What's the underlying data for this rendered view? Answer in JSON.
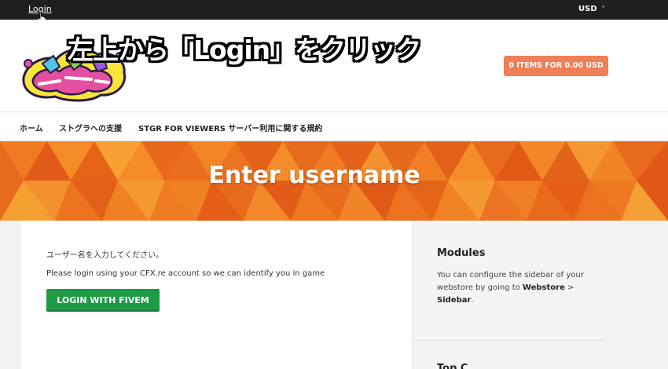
{
  "topbar": {
    "login_label": "Login",
    "currency_label": "USD",
    "currency_chevron": "˅"
  },
  "header": {
    "overlay_caption": "左上から「Login」をクリック",
    "cart_label": "0 ITEMS FOR 0.00 USD",
    "logo_icon": "graffiti-logo"
  },
  "nav": {
    "items": [
      {
        "label": "ホーム"
      },
      {
        "label": "ストグラへの支援"
      },
      {
        "label": "STGR FOR VIEWERS サーバー利用に関する規約"
      }
    ]
  },
  "banner": {
    "title": "Enter username"
  },
  "main": {
    "jp_instruction": "ユーザー名を入力してください。",
    "message": "Please login using your CFX.re account so we can identify you in game",
    "login_button": "LOGIN WITH FIVEM"
  },
  "sidebar": {
    "modules_title": "Modules",
    "modules_text_1": "You can configure the sidebar of your webstore by going to ",
    "modules_text_webstore": "Webstore",
    "modules_text_sep": " > ",
    "modules_text_sidebar": "Sidebar",
    "modules_text_end": ".",
    "next_title": "Top C"
  },
  "colors": {
    "topbar_bg": "#1f1f1f",
    "cart_button": "#ee7f56",
    "banner_orange": "#e8641e",
    "fivem_green": "#1f9a45"
  }
}
